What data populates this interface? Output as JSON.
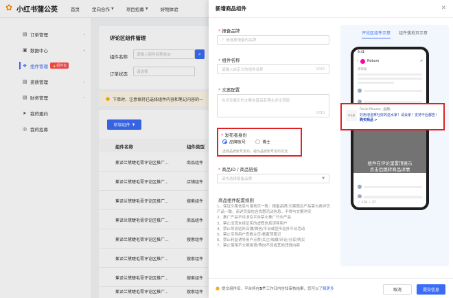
{
  "app": {
    "brand": "小红书蒲公英"
  },
  "topnav": [
    {
      "label": "首页",
      "chev": false
    },
    {
      "label": "定向合作",
      "chev": true
    },
    {
      "label": "项目招募",
      "chev": true
    },
    {
      "label": "好物体验",
      "chev": false
    }
  ],
  "sidebar": {
    "items": [
      {
        "label": "订单管理",
        "icon": "▤",
        "chev": "⌄"
      },
      {
        "label": "数据中心",
        "icon": "▣",
        "chev": "⌄"
      },
      {
        "label": "组件管理",
        "icon": "❖",
        "badge": "🔥组件化",
        "chev": ""
      },
      {
        "label": "资质管理",
        "icon": "▤",
        "chev": "⌄"
      },
      {
        "label": "财务管理",
        "icon": "▤",
        "chev": "⌄"
      },
      {
        "label": "我的邀约",
        "icon": "➤",
        "chev": ""
      },
      {
        "label": "我的招募",
        "icon": "◎",
        "chev": ""
      }
    ]
  },
  "page": {
    "title": "评论区组件管理",
    "filter_component_label": "组件名称",
    "filter_component_placeholder": "请输入组件名称或ID",
    "filter_status_label": "订单状态",
    "filter_status_placeholder": "请选择",
    "search_icon": "⌕",
    "notice": "下单时，注意保持已选择组件内容和笔记内容的一",
    "add_button": "新增组件",
    "table": {
      "headers": [
        "组件名称",
        "组件类型"
      ],
      "rows": [
        [
          "蕉译兰黛睫毛膏评论区推广...",
          "商品组件"
        ],
        [
          "蕉译兰黛睫毛膏评论区推广...",
          "店铺组件"
        ],
        [
          "蕉译兰黛睫毛膏评论区推广...",
          "搜索组件"
        ],
        [
          "蕉译兰黛睫毛膏评论区推广...",
          "商品组件"
        ],
        [
          "蕉译兰黛睫毛膏评论区推广...",
          "搜索组件"
        ],
        [
          "蕉译兰黛睫毛膏评论区推广...",
          "搜索组件"
        ],
        [
          "蕉译兰黛睫毛膏评论区推广...",
          "搜索组件"
        ],
        [
          "蕉译兰黛睫毛膏评论区推广...",
          "搜索组件"
        ]
      ]
    }
  },
  "drawer": {
    "title": "新增商品组件",
    "close": "✕",
    "brand_label": "报备品牌",
    "brand_placeholder": "请选择报备的品牌",
    "name_label": "组件名称",
    "name_placeholder": "请输入自定义的组件名称",
    "name_count": "0/20",
    "copy_label": "文案配置",
    "copy_placeholder": "在评论展示的文案含普品有博主评论顶部",
    "copy_count": "0/30",
    "role_label": "发布者身份",
    "role_options": [
      "品牌账号",
      "博主"
    ],
    "role_hint": "选择品牌账号发布，视为品牌账号发布引流",
    "product_label": "商品ID / 商品链接",
    "product_placeholder": "请先选择报备品牌",
    "rules_title": "商品组件配置规则",
    "rules": [
      "1、保证文案信息与落地页一致：报备品牌/文案题及产品需与商详页产品一致，商详页如包含优惠活动信息，不得与文案冲突",
      "2、推广产品不许涉及平台禁止推广行业产品",
      "3、禁止出现未经证实的虚假信息误导用户",
      "4、禁止导流站外店铺/微信/平台或宣传站外平台活动",
      "5、禁止引导用户查看主页/看置顶笔记",
      "6、禁止利益诱导用户点赞/关注/收藏/评论/分享/购买",
      "7、禁止使用不文明用语/等向不佳或其他违规内容"
    ],
    "footer_tip_prefix": "提交组件后，平台将在",
    "footer_tip_bold": "5个",
    "footer_tip_suffix": "工作日内告知审核结果，您可以了",
    "footer_tip_link": "解更多",
    "cancel": "取消",
    "submit": "提交信息"
  },
  "preview": {
    "tabs": [
      "评论区组件示意",
      "组件落地页示意"
    ],
    "phone_time": "9:41",
    "phone_user": "Rebom",
    "phone_status": "待审核",
    "card_thumb": "商品图",
    "card_brand": "Facial Mousse",
    "card_tag": "品牌",
    "card_text": "好用泡泡拿吐好的这水家！请会家！支持干后都告！",
    "card_link": "购买商品 >",
    "overlay_text_1": "组件在评论里置顶展示",
    "overlay_text_2": "点击后跳转商品详情",
    "bottom_bar": "♡ 176  ☆ 27"
  },
  "colors": {
    "accent": "#3b6cf6",
    "highlight": "#e02020",
    "warn": "#faad14"
  }
}
